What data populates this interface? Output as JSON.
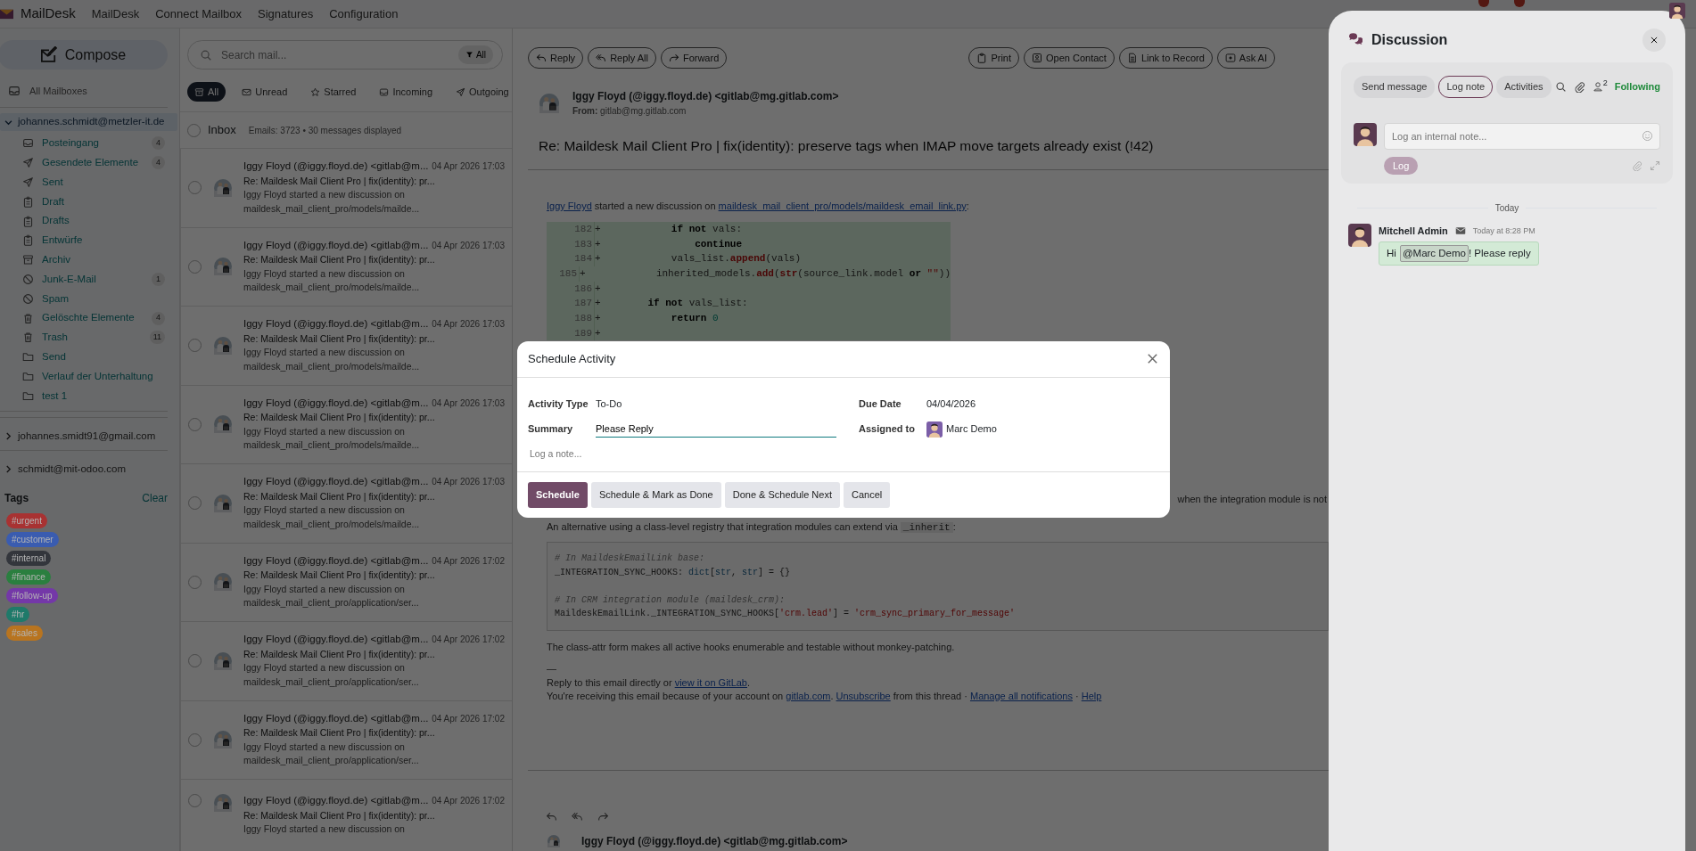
{
  "navbar": {
    "brand": "MailDesk",
    "menu": [
      "MailDesk",
      "Connect Mailbox",
      "Signatures",
      "Configuration"
    ]
  },
  "sidebar": {
    "compose": "Compose",
    "all_mailboxes": "All Mailboxes",
    "accounts": [
      {
        "email": "johannes.schmidt@metzler-it.de",
        "expanded": true,
        "selected": true,
        "folders": [
          {
            "name": "Posteingang",
            "kind": "inbox",
            "count": "4"
          },
          {
            "name": "Gesendete Elemente",
            "kind": "send",
            "count": "4"
          },
          {
            "name": "Sent",
            "kind": "send"
          },
          {
            "name": "Draft",
            "kind": "clipboard"
          },
          {
            "name": "Drafts",
            "kind": "clipboard"
          },
          {
            "name": "Entwürfe",
            "kind": "clipboard"
          },
          {
            "name": "Archiv",
            "kind": "archive"
          },
          {
            "name": "Junk-E-Mail",
            "kind": "ban",
            "count": "1"
          },
          {
            "name": "Spam",
            "kind": "ban"
          },
          {
            "name": "Gelöschte Elemente",
            "kind": "trash",
            "count": "4"
          },
          {
            "name": "Trash",
            "kind": "trash",
            "count": "11"
          },
          {
            "name": "Send",
            "kind": "folder"
          },
          {
            "name": "Verlauf der Unterhaltung",
            "kind": "folder"
          },
          {
            "name": "test 1",
            "kind": "folder"
          }
        ]
      },
      {
        "email": "johannes.smidt91@gmail.com",
        "expanded": false,
        "selected": false
      },
      {
        "email": "schmidt@mit-odoo.com",
        "expanded": false,
        "selected": false
      }
    ],
    "tags_title": "Tags",
    "clear": "Clear",
    "tags": [
      {
        "label": "#urgent",
        "color": "#a83232"
      },
      {
        "label": "#customer",
        "color": "#3a5cb0"
      },
      {
        "label": "#internal",
        "color": "#33363c"
      },
      {
        "label": "#finance",
        "color": "#2a7f3f"
      },
      {
        "label": "#follow-up",
        "color": "#7438a8"
      },
      {
        "label": "#hr",
        "color": "#1f7a6a"
      },
      {
        "label": "#sales",
        "color": "#b8741f"
      }
    ]
  },
  "mail_list": {
    "search_placeholder": "Search mail...",
    "filter_button": "All",
    "filters": [
      {
        "label": "All",
        "kind": "all",
        "selected": true
      },
      {
        "label": "Unread",
        "kind": "unread",
        "selected": false
      },
      {
        "label": "Starred",
        "kind": "starred",
        "selected": false
      },
      {
        "label": "Incoming",
        "kind": "incoming",
        "selected": false
      },
      {
        "label": "Outgoing",
        "kind": "outgoing",
        "selected": false
      }
    ],
    "folder_title": "Inbox",
    "folder_checked": false,
    "summary": "Emails: 3723 • 30 messages displayed",
    "items": [
      {
        "sender": "Iggy Floyd (@iggy.floyd.de) <gitlab@m...",
        "date": "04 Apr 2026 17:03",
        "subject": "Re: Maildesk Mail Client Pro | fix(identity): pr...",
        "preview": [
          "Iggy Floyd started a new discussion on",
          "maildesk_mail_client_pro/models/mailde..."
        ],
        "checked": false
      },
      {
        "sender": "Iggy Floyd (@iggy.floyd.de) <gitlab@m...",
        "date": "04 Apr 2026 17:03",
        "subject": "Re: Maildesk Mail Client Pro | fix(identity): pr...",
        "preview": [
          "Iggy Floyd started a new discussion on",
          "maildesk_mail_client_pro/models/mailde..."
        ],
        "checked": false
      },
      {
        "sender": "Iggy Floyd (@iggy.floyd.de) <gitlab@m...",
        "date": "04 Apr 2026 17:03",
        "subject": "Re: Maildesk Mail Client Pro | fix(identity): pr...",
        "preview": [
          "Iggy Floyd started a new discussion on",
          "maildesk_mail_client_pro/models/mailde..."
        ],
        "checked": false
      },
      {
        "sender": "Iggy Floyd (@iggy.floyd.de) <gitlab@m...",
        "date": "04 Apr 2026 17:03",
        "subject": "Re: Maildesk Mail Client Pro | fix(identity): pr...",
        "preview": [
          "Iggy Floyd started a new discussion on",
          "maildesk_mail_client_pro/models/mailde..."
        ],
        "checked": false
      },
      {
        "sender": "Iggy Floyd (@iggy.floyd.de) <gitlab@m...",
        "date": "04 Apr 2026 17:03",
        "subject": "Re: Maildesk Mail Client Pro | fix(identity): pr...",
        "preview": [
          "Iggy Floyd started a new discussion on",
          "maildesk_mail_client_pro/models/mailde..."
        ],
        "checked": false
      },
      {
        "sender": "Iggy Floyd (@iggy.floyd.de) <gitlab@m...",
        "date": "04 Apr 2026 17:02",
        "subject": "Re: Maildesk Mail Client Pro | fix(identity): pr...",
        "preview": [
          "Iggy Floyd started a new discussion on",
          "maildesk_mail_client_pro/application/ser..."
        ],
        "checked": false
      },
      {
        "sender": "Iggy Floyd (@iggy.floyd.de) <gitlab@m...",
        "date": "04 Apr 2026 17:02",
        "subject": "Re: Maildesk Mail Client Pro | fix(identity): pr...",
        "preview": [
          "Iggy Floyd started a new discussion on",
          "maildesk_mail_client_pro/application/ser..."
        ],
        "checked": false
      },
      {
        "sender": "Iggy Floyd (@iggy.floyd.de) <gitlab@m...",
        "date": "04 Apr 2026 17:02",
        "subject": "Re: Maildesk Mail Client Pro | fix(identity): pr...",
        "preview": [
          "Iggy Floyd started a new discussion on",
          "maildesk_mail_client_pro/application/ser..."
        ],
        "checked": false
      },
      {
        "sender": "Iggy Floyd (@iggy.floyd.de) <gitlab@m...",
        "date": "04 Apr 2026 17:02",
        "subject": "Re: Maildesk Mail Client Pro | fix(identity): pr...",
        "preview": [
          "Iggy Floyd started a new discussion on"
        ],
        "checked": false
      }
    ]
  },
  "email": {
    "toolbar_left": [
      {
        "label": "Reply",
        "kind": "reply"
      },
      {
        "label": "Reply All",
        "kind": "replyall"
      },
      {
        "label": "Forward",
        "kind": "forward"
      }
    ],
    "toolbar_right": [
      {
        "label": "Print",
        "kind": "print"
      },
      {
        "label": "Open Contact",
        "kind": "contact"
      },
      {
        "label": "Link to Record",
        "kind": "doc"
      },
      {
        "label": "Ask AI",
        "kind": "ai"
      }
    ],
    "sender": "Iggy Floyd (@iggy.floyd.de) <gitlab@mg.gitlab.com>",
    "from_label": "From:",
    "from": "gitlab@mg.gitlab.com",
    "subject": "Re: Maildesk Mail Client Pro | fix(identity): preserve tags when IMAP move targets already exist (!42)",
    "intro": [
      {
        "text": "Iggy Floyd",
        "kind": "link"
      },
      {
        "text": " started a new discussion on ",
        "kind": "text"
      },
      {
        "text": "maildesk_mail_client_pro/models/maildesk_email_link.py",
        "kind": "link"
      },
      {
        "text": ":",
        "kind": "text"
      }
    ],
    "diff": [
      {
        "num": "182",
        "sign": "+",
        "tokens": [
          {
            "text": "            if not",
            "kind": "kw"
          },
          {
            "text": " vals:",
            "kind": "plain"
          }
        ]
      },
      {
        "num": "183",
        "sign": "+",
        "tokens": [
          {
            "text": "                continue",
            "kind": "kw"
          }
        ]
      },
      {
        "num": "184",
        "sign": "+",
        "tokens": [
          {
            "text": "            vals_list.",
            "kind": "plain"
          },
          {
            "text": "append",
            "kind": "fn"
          },
          {
            "text": "(vals)",
            "kind": "plain"
          }
        ]
      },
      {
        "num": "185",
        "sign": "+",
        "tokens": [
          {
            "text": "            inherited_models.",
            "kind": "plain"
          },
          {
            "text": "add",
            "kind": "fn"
          },
          {
            "text": "(",
            "kind": "plain"
          },
          {
            "text": "str",
            "kind": "fn"
          },
          {
            "text": "(source_link.model ",
            "kind": "plain"
          },
          {
            "text": "or",
            "kind": "kw"
          },
          {
            "text": " \"\"",
            "kind": "str"
          },
          {
            "text": "))",
            "kind": "plain"
          }
        ]
      },
      {
        "num": "186",
        "sign": "+"
      },
      {
        "num": "187",
        "sign": "+",
        "tokens": [
          {
            "text": "        if not",
            "kind": "kw"
          },
          {
            "text": " vals_list:",
            "kind": "plain"
          }
        ]
      },
      {
        "num": "188",
        "sign": "+",
        "tokens": [
          {
            "text": "            return",
            "kind": "kw"
          },
          {
            "text": " 0",
            "kind": "num"
          }
        ]
      },
      {
        "num": "189",
        "sign": "+"
      }
    ],
    "hidden_tail": "when the integration module is not",
    "alt": [
      {
        "text": "An alternative using a class-level registry that integration modules can extend via ",
        "kind": "text"
      },
      {
        "text": "_inherit",
        "kind": "code"
      },
      {
        "text": ":",
        "kind": "text"
      }
    ],
    "code": [
      {
        "kind": "code",
        "tokens": [
          {
            "text": "# In MaildeskEmailLink base:",
            "kind": "cm"
          }
        ]
      },
      {
        "kind": "code",
        "tokens": [
          {
            "text": "_INTEGRATION_SYNC_HOOKS: ",
            "kind": "plain"
          },
          {
            "text": "dict",
            "kind": "ty"
          },
          {
            "text": "[",
            "kind": "plain"
          },
          {
            "text": "str",
            "kind": "ty"
          },
          {
            "text": ", ",
            "kind": "plain"
          },
          {
            "text": "str",
            "kind": "ty"
          },
          {
            "text": "] = {}",
            "kind": "plain"
          }
        ]
      },
      {
        "kind": "blank"
      },
      {
        "kind": "code",
        "tokens": [
          {
            "text": "# In CRM integration module (maildesk_crm):",
            "kind": "cm"
          }
        ]
      },
      {
        "kind": "code",
        "tokens": [
          {
            "text": "MaildeskEmailLink._INTEGRATION_SYNC_HOOKS[",
            "kind": "plain"
          },
          {
            "text": "'crm.lead'",
            "kind": "str"
          },
          {
            "text": "] = ",
            "kind": "plain"
          },
          {
            "text": "'crm_sync_primary_for_message'",
            "kind": "str"
          }
        ]
      }
    ],
    "closing": "The class-attr form makes all active hooks enumerable and testable without monkey-patching.",
    "separator": "—",
    "footer": [
      [
        {
          "text": "Reply to this email directly or ",
          "kind": "text"
        },
        {
          "text": "view it on GitLab",
          "kind": "link"
        },
        {
          "text": ".",
          "kind": "text"
        }
      ],
      [
        {
          "text": "You're receiving this email because of your account on ",
          "kind": "text"
        },
        {
          "text": "gitlab.com",
          "kind": "link"
        },
        {
          "text": ". ",
          "kind": "text"
        },
        {
          "text": "Unsubscribe",
          "kind": "link"
        },
        {
          "text": " from this thread · ",
          "kind": "text"
        },
        {
          "text": "Manage all notifications",
          "kind": "link"
        },
        {
          "text": " · ",
          "kind": "text"
        },
        {
          "text": "Help",
          "kind": "link"
        }
      ]
    ],
    "next_sender": "Iggy Floyd (@iggy.floyd.de) <gitlab@mg.gitlab.com>"
  },
  "modal": {
    "title": "Schedule Activity",
    "fields": [
      {
        "label": "Activity Type",
        "value": "To-Do",
        "kind": "text"
      },
      {
        "label": "Due Date",
        "value": "04/04/2026",
        "kind": "text"
      },
      {
        "label": "Summary",
        "value": "Please Reply",
        "kind": "input"
      },
      {
        "label": "Assigned to",
        "value": "Marc Demo",
        "kind": "user"
      }
    ],
    "note_placeholder": "Log a note...",
    "buttons": [
      {
        "label": "Schedule",
        "kind": "primary"
      },
      {
        "label": "Schedule & Mark as Done",
        "kind": "secondary"
      },
      {
        "label": "Done & Schedule Next",
        "kind": "secondary"
      },
      {
        "label": "Cancel",
        "kind": "secondary"
      }
    ]
  },
  "discussion": {
    "title": "Discussion",
    "tabs": [
      {
        "label": "Send message",
        "selected": false
      },
      {
        "label": "Log note",
        "selected": true
      },
      {
        "label": "Activities",
        "selected": false
      }
    ],
    "followers": "2",
    "following": "Following",
    "composer_placeholder": "Log an internal note...",
    "log_button": "Log",
    "date_divider": "Today",
    "message": {
      "author": "Mitchell Admin",
      "time": "Today at 8:28 PM",
      "greeting": "Hi",
      "mention": "@Marc Demo",
      "text": "! Please reply"
    }
  }
}
